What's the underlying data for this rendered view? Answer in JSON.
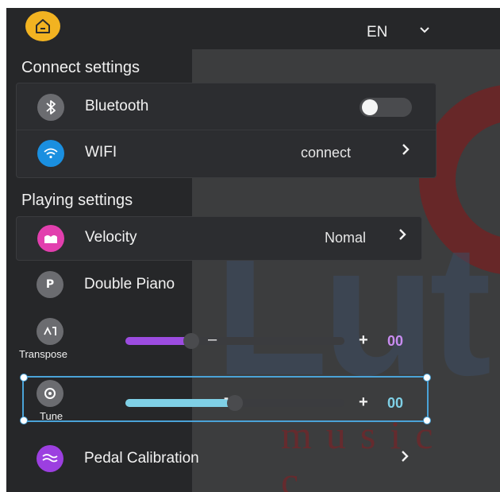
{
  "language": "EN",
  "sections": {
    "connect_title": "Connect settings",
    "playing_title": "Playing settings"
  },
  "connect": {
    "bluetooth": {
      "label": "Bluetooth",
      "icon": "bluetooth-icon",
      "enabled": false
    },
    "wifi": {
      "label": "WIFI",
      "icon": "wifi-icon",
      "value": "connect"
    }
  },
  "playing": {
    "velocity": {
      "label": "Velocity",
      "icon": "velocity-icon",
      "value": "Nomal"
    },
    "double_piano": {
      "label": "Double Piano",
      "icon": "double-piano-icon"
    },
    "transpose": {
      "label": "Transpose",
      "icon": "transpose-icon",
      "minus": "–",
      "plus": "+",
      "value": "00",
      "level": 0.3
    },
    "tune": {
      "label": "Tune",
      "icon": "tune-icon",
      "minus": "-",
      "plus": "+",
      "value": "00",
      "level": 0.5
    },
    "pedal": {
      "label": "Pedal Calibration",
      "icon": "pedal-icon"
    }
  },
  "colors": {
    "home": "#f2b321",
    "wifi": "#1a8fe0",
    "velocity": "#e23fae",
    "pedal": "#9c3fe0",
    "transpose_fill": "#9c4ce0",
    "transpose_value": "#c88cf0",
    "tune_fill": "#7fd0e6",
    "tune_value": "#7fd0e6",
    "selection": "#4aa3d8"
  },
  "background_watermark": {
    "word": "Lut",
    "sub": "music c"
  }
}
